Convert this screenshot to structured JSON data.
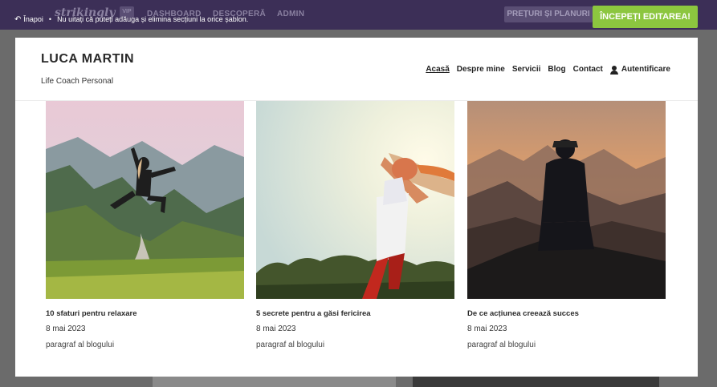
{
  "topbar": {
    "logo": "strikingly",
    "vip": "VIP",
    "nav": [
      "DASHBOARD",
      "DESCOPERĂ",
      "ADMIN"
    ],
    "pricing_label": "PREȚURI ȘI PLANURI",
    "start_label": "ÎNCEPEȚI EDITAREA!",
    "back_label": "Înapoi",
    "notice": "Nu uitați că puteți adăuga și elimina secțiuni la orice șablon."
  },
  "site": {
    "name": "LUCA MARTIN",
    "tagline": "Life Coach Personal",
    "menu": [
      "Acasă",
      "Despre mine",
      "Servicii",
      "Blog",
      "Contact"
    ],
    "login_label": "Autentificare"
  },
  "posts": [
    {
      "title": "10 sfaturi pentru relaxare",
      "date": "8 mai 2023",
      "excerpt": "paragraf al blogului"
    },
    {
      "title": "5 secrete pentru a găsi fericirea",
      "date": "8 mai 2023",
      "excerpt": "paragraf al blogului"
    },
    {
      "title": "De ce acțiunea creează succes",
      "date": "8 mai 2023",
      "excerpt": "paragraf al blogului"
    }
  ],
  "colors": {
    "topbar": "#3c2f57",
    "accent_green": "#8cc63f"
  }
}
